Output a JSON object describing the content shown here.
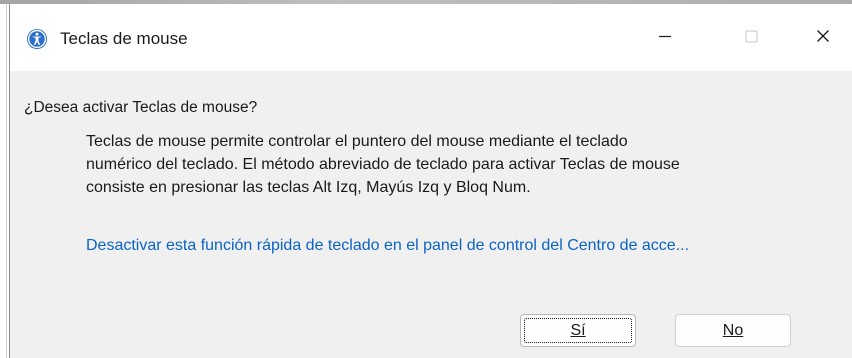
{
  "window": {
    "title": "Teclas de mouse",
    "icon": "accessibility-icon",
    "controls": {
      "minimize_icon": "minimize-icon",
      "maximize_icon": "maximize-icon",
      "close_icon": "close-icon"
    }
  },
  "dialog": {
    "question": "¿Desea activar Teclas de mouse?",
    "description_lines": [
      "Teclas de mouse permite controlar el puntero del mouse mediante el teclado",
      "numérico del teclado. El método abreviado de teclado para activar Teclas de mouse",
      "consiste en presionar las teclas Alt Izq, Mayús Izq y Bloq Num."
    ],
    "link_text": "Desactivar esta función rápida de teclado en el panel de control del Centro de acce...",
    "buttons": {
      "yes_label": "Sí",
      "no_label": "No"
    }
  },
  "colors": {
    "link": "#0b63c6",
    "dialog_background": "#f0f0f0",
    "titlebar_background": "#ffffff"
  }
}
